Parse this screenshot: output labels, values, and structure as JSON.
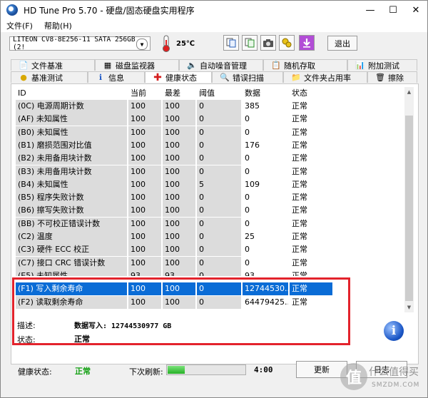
{
  "window": {
    "title": "HD Tune Pro 5.70 - 硬盘/固态硬盘实用程序",
    "min_icon": "minimize-icon",
    "max_icon": "maximize-icon",
    "close_icon": "close-icon"
  },
  "menu": [
    "文件(F)",
    "帮助(H)"
  ],
  "toolbar": {
    "drive": "LITEON CV8-8E256-11 SATA 256GB (2!",
    "temperature": "25℃",
    "exit_label": "退出",
    "buttons": [
      "copy-info-icon",
      "copy-all-icon",
      "screenshot-icon",
      "options-icon",
      "save-down-icon"
    ]
  },
  "tabs_top": [
    "文件基准",
    "磁盘监视器",
    "自动噪音管理",
    "随机存取",
    "附加测试"
  ],
  "tabs_bottom": [
    "基准测试",
    "信息",
    "健康状态",
    "错误扫描",
    "文件夹占用率",
    "擦除"
  ],
  "active_tab": "健康状态",
  "table": {
    "headers": [
      "ID",
      "当前",
      "最差",
      "阈值",
      "数据",
      "状态"
    ],
    "rows": [
      [
        "(0C) 电源周期计数",
        "100",
        "100",
        "0",
        "385",
        "正常"
      ],
      [
        "(AF) 未知属性",
        "100",
        "100",
        "0",
        "0",
        "正常"
      ],
      [
        "(B0) 未知属性",
        "100",
        "100",
        "0",
        "0",
        "正常"
      ],
      [
        "(B1) 磨损范围对比值",
        "100",
        "100",
        "0",
        "176",
        "正常"
      ],
      [
        "(B2) 未用备用块计数",
        "100",
        "100",
        "0",
        "0",
        "正常"
      ],
      [
        "(B3) 未用备用块计数",
        "100",
        "100",
        "0",
        "0",
        "正常"
      ],
      [
        "(B4) 未知属性",
        "100",
        "100",
        "5",
        "109",
        "正常"
      ],
      [
        "(B5) 程序失败计数",
        "100",
        "100",
        "0",
        "0",
        "正常"
      ],
      [
        "(B6) 擦写失败计数",
        "100",
        "100",
        "0",
        "0",
        "正常"
      ],
      [
        "(BB) 不可校正错误计数",
        "100",
        "100",
        "0",
        "0",
        "正常"
      ],
      [
        "(C2) 温度",
        "100",
        "100",
        "0",
        "25",
        "正常"
      ],
      [
        "(C3) 硬件 ECC 校正",
        "100",
        "100",
        "0",
        "0",
        "正常"
      ],
      [
        "(C7) 接口 CRC 错误计数",
        "100",
        "100",
        "0",
        "0",
        "正常"
      ],
      [
        "(E5) 未知属性",
        "93",
        "93",
        "0",
        "93",
        "正常"
      ],
      [
        "(F1) 写入剩余寿命",
        "100",
        "100",
        "0",
        "12744530...",
        "正常"
      ],
      [
        "(F2) 读取剩余寿命",
        "100",
        "100",
        "0",
        "64479425...",
        "正常"
      ]
    ],
    "selected_row": 14
  },
  "details": {
    "desc_label": "描述:",
    "desc_value": "数据写入: 12744530977 GB",
    "state_label": "状态:",
    "state_value": "正常"
  },
  "status": {
    "health_label": "健康状态:",
    "health_value": "正常",
    "refresh_label": "下次刷新:",
    "progress_fraction": 0.22,
    "countdown": "4:00",
    "refresh_button": "更新",
    "log_button": "日志"
  },
  "colors": {
    "selection": "#0a6cd6",
    "ok_green": "#12a012",
    "highlight_box": "#e3232c"
  },
  "watermark": {
    "cn": "什么值得买",
    "en": "SMZDM.COM",
    "glyph": "值"
  }
}
